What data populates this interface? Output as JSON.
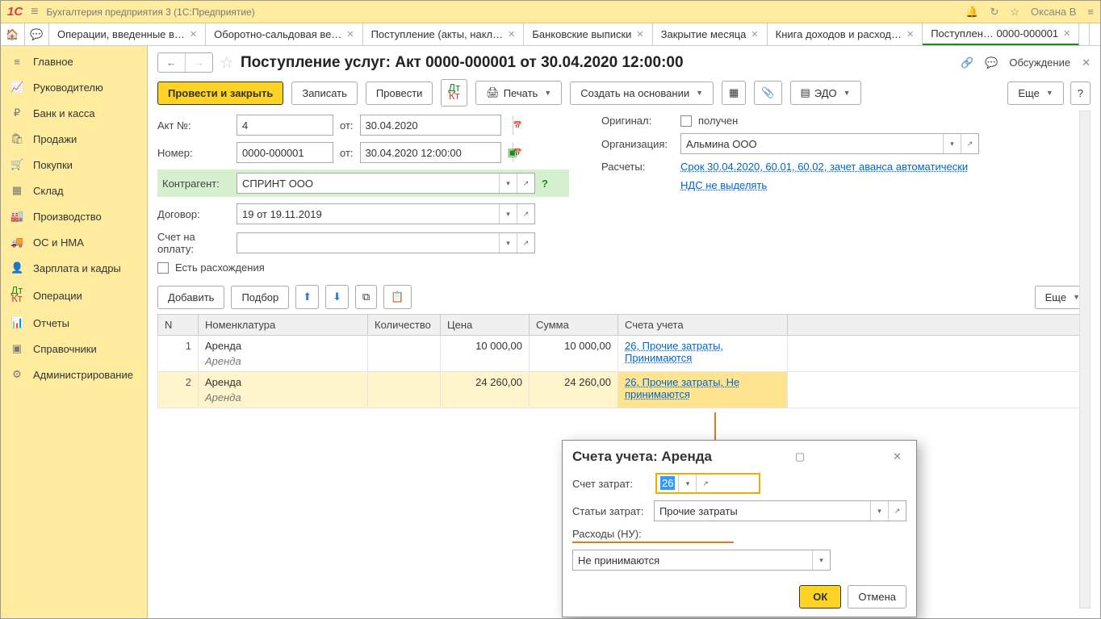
{
  "app": {
    "title": "Бухгалтерия предприятия 3  (1С:Предприятие)",
    "user": "Оксана В"
  },
  "tabs": [
    {
      "label": "Операции, введенные в…"
    },
    {
      "label": "Оборотно-сальдовая ве…"
    },
    {
      "label": "Поступление (акты, накл…"
    },
    {
      "label": "Банковские выписки"
    },
    {
      "label": "Закрытие месяца"
    },
    {
      "label": "Книга доходов и расход…"
    },
    {
      "label": "Поступлен…  0000-000001"
    }
  ],
  "sidebar": [
    {
      "icon": "≡",
      "label": "Главное"
    },
    {
      "icon": "📈",
      "label": "Руководителю"
    },
    {
      "icon": "₽",
      "label": "Банк и касса"
    },
    {
      "icon": "🛍",
      "label": "Продажи"
    },
    {
      "icon": "🛒",
      "label": "Покупки"
    },
    {
      "icon": "📦",
      "label": "Склад"
    },
    {
      "icon": "🏭",
      "label": "Производство"
    },
    {
      "icon": "🚚",
      "label": "ОС и НМА"
    },
    {
      "icon": "👤",
      "label": "Зарплата и кадры"
    },
    {
      "icon": "Дт",
      "label": "Операции"
    },
    {
      "icon": "📊",
      "label": "Отчеты"
    },
    {
      "icon": "📚",
      "label": "Справочники"
    },
    {
      "icon": "⚙",
      "label": "Администрирование"
    }
  ],
  "doc": {
    "title": "Поступление услуг: Акт 0000-000001 от 30.04.2020 12:00:00",
    "discuss": "Обсуждение"
  },
  "toolbar": {
    "post_close": "Провести и закрыть",
    "save": "Записать",
    "post": "Провести",
    "print": "Печать",
    "create_based": "Создать на основании",
    "edo": "ЭДО",
    "more": "Еще"
  },
  "form": {
    "act_no_lbl": "Акт №:",
    "act_no": "4",
    "ot": "от:",
    "act_date": "30.04.2020",
    "num_lbl": "Номер:",
    "num": "0000-000001",
    "num_date": "30.04.2020 12:00:00",
    "contractor_lbl": "Контрагент:",
    "contractor": "СПРИНТ ООО",
    "contract_lbl": "Договор:",
    "contract": "19 от 19.11.2019",
    "invoice_lbl": "Счет на оплату:",
    "invoice": "",
    "discrep_lbl": "Есть расхождения",
    "original_lbl": "Оригинал:",
    "original_chk": "получен",
    "org_lbl": "Организация:",
    "org": "Альмина ООО",
    "calc_lbl": "Расчеты:",
    "calc_link": "Срок 30.04.2020, 60.01, 60.02, зачет аванса автоматически",
    "vat_link": "НДС не выделять"
  },
  "tabletb": {
    "add": "Добавить",
    "pick": "Подбор",
    "more": "Еще"
  },
  "cols": {
    "n": "N",
    "nomen": "Номенклатура",
    "qty": "Количество",
    "price": "Цена",
    "sum": "Сумма",
    "acc": "Счета учета"
  },
  "rows": [
    {
      "n": "1",
      "nomen": "Аренда",
      "sub": "Аренда",
      "price": "10 000,00",
      "sum": "10 000,00",
      "acc": "26, Прочие затраты, Принимаются"
    },
    {
      "n": "2",
      "nomen": "Аренда",
      "sub": "Аренда",
      "price": "24 260,00",
      "sum": "24 260,00",
      "acc": "26, Прочие затраты, Не принимаются"
    }
  ],
  "popup": {
    "title": "Счета учета: Аренда",
    "acc_lbl": "Счет затрат:",
    "acc": "26",
    "item_lbl": "Статьи затрат:",
    "item": "Прочие затраты",
    "exp_lbl": "Расходы (НУ):",
    "exp": "Не принимаются",
    "ok": "ОК",
    "cancel": "Отмена"
  }
}
